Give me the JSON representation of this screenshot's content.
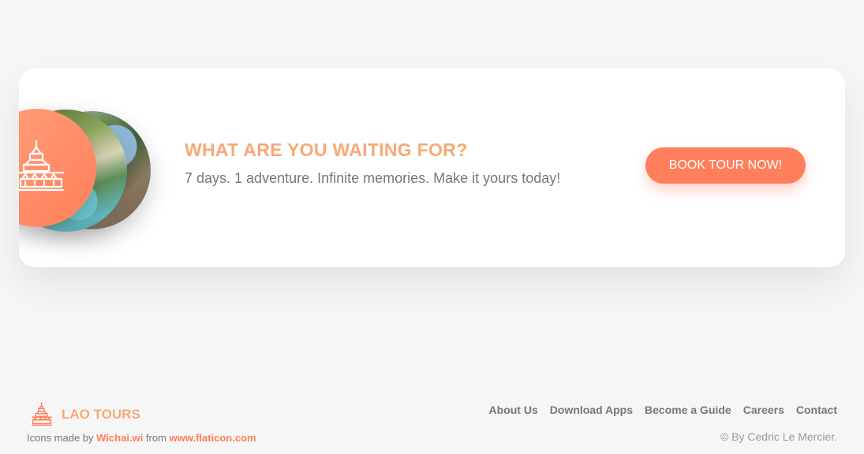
{
  "cta": {
    "title": "WHAT ARE YOU WAITING FOR?",
    "subtitle": "7 days. 1 adventure. Infinite memories. Make it yours today!",
    "button_label": "BOOK TOUR NOW!",
    "icon": "temple-icon"
  },
  "footer": {
    "logo_text": "LAO TOURS",
    "logo_icon": "temple-icon",
    "credit": {
      "prefix": "Icons made by ",
      "author": "Wichai.wi",
      "middle": " from ",
      "site": "www.flaticon.com"
    },
    "nav": [
      {
        "label": "About Us"
      },
      {
        "label": "Download Apps"
      },
      {
        "label": "Become a Guide"
      },
      {
        "label": "Careers"
      },
      {
        "label": "Contact"
      }
    ],
    "copyright": "© By Cedric Le Mercier."
  },
  "colors": {
    "accent": "#ff7f5c",
    "accent_light": "#f8a877",
    "text": "#777777",
    "background": "#f6f6f6"
  }
}
